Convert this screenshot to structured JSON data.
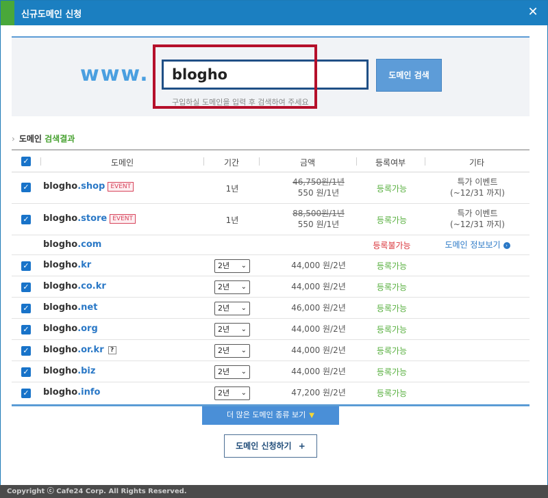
{
  "window": {
    "title": "신규도메인 신청",
    "close_label": "✕"
  },
  "search": {
    "prefix": "www.",
    "value": "blogho",
    "button_label": "도메인 검색",
    "hint": "구입하실 도메인을 입력 후 검색하여 주세요"
  },
  "results": {
    "header_prefix": "도메인",
    "header_highlight": "검색결과",
    "columns": [
      "도메인",
      "기간",
      "금액",
      "등록여부",
      "기타"
    ]
  },
  "rows": [
    {
      "name": "blogho",
      "tld": ".shop",
      "badge": "EVENT",
      "checked": true,
      "period": "1년",
      "price_old": "46,750원/1년",
      "price": "550 원/1년",
      "status": "등록가능",
      "etc1": "특가 이벤트",
      "etc2": "(~12/31 까지)"
    },
    {
      "name": "blogho",
      "tld": ".store",
      "badge": "EVENT",
      "checked": true,
      "period": "1년",
      "price_old": "88,500원/1년",
      "price": "550 원/1년",
      "status": "등록가능",
      "etc1": "특가 이벤트",
      "etc2": "(~12/31 까지)"
    },
    {
      "name": "blogho",
      "tld": ".com",
      "checked": false,
      "status": "등록불가능",
      "etc_link": "도메인 정보보기"
    },
    {
      "name": "blogho",
      "tld": ".kr",
      "checked": true,
      "period": "2년",
      "price": "44,000 원/2년",
      "status": "등록가능"
    },
    {
      "name": "blogho",
      "tld": ".co.kr",
      "checked": true,
      "period": "2년",
      "price": "44,000 원/2년",
      "status": "등록가능"
    },
    {
      "name": "blogho",
      "tld": ".net",
      "checked": true,
      "period": "2년",
      "price": "46,000 원/2년",
      "status": "등록가능"
    },
    {
      "name": "blogho",
      "tld": ".org",
      "checked": true,
      "period": "2년",
      "price": "44,000 원/2년",
      "status": "등록가능"
    },
    {
      "name": "blogho",
      "tld": ".or.kr",
      "help": "?",
      "checked": true,
      "period": "2년",
      "price": "44,000 원/2년",
      "status": "등록가능"
    },
    {
      "name": "blogho",
      "tld": ".biz",
      "checked": true,
      "period": "2년",
      "price": "44,000 원/2년",
      "status": "등록가능"
    },
    {
      "name": "blogho",
      "tld": ".info",
      "checked": true,
      "period": "2년",
      "price": "47,200 원/2년",
      "status": "등록가능"
    }
  ],
  "more_button": "더 많은 도메인 종류 보기",
  "apply_button": "도메인 신청하기",
  "apply_icon": "+",
  "footer": "Copyright  ⓒ  Cafe24 Corp. All Rights Reserved.",
  "colors": {
    "titlebar": "#1b7fc1",
    "accent": "#49a83a",
    "available": "#59b040",
    "unavailable": "#d9343a",
    "tld": "#2a78c6"
  }
}
